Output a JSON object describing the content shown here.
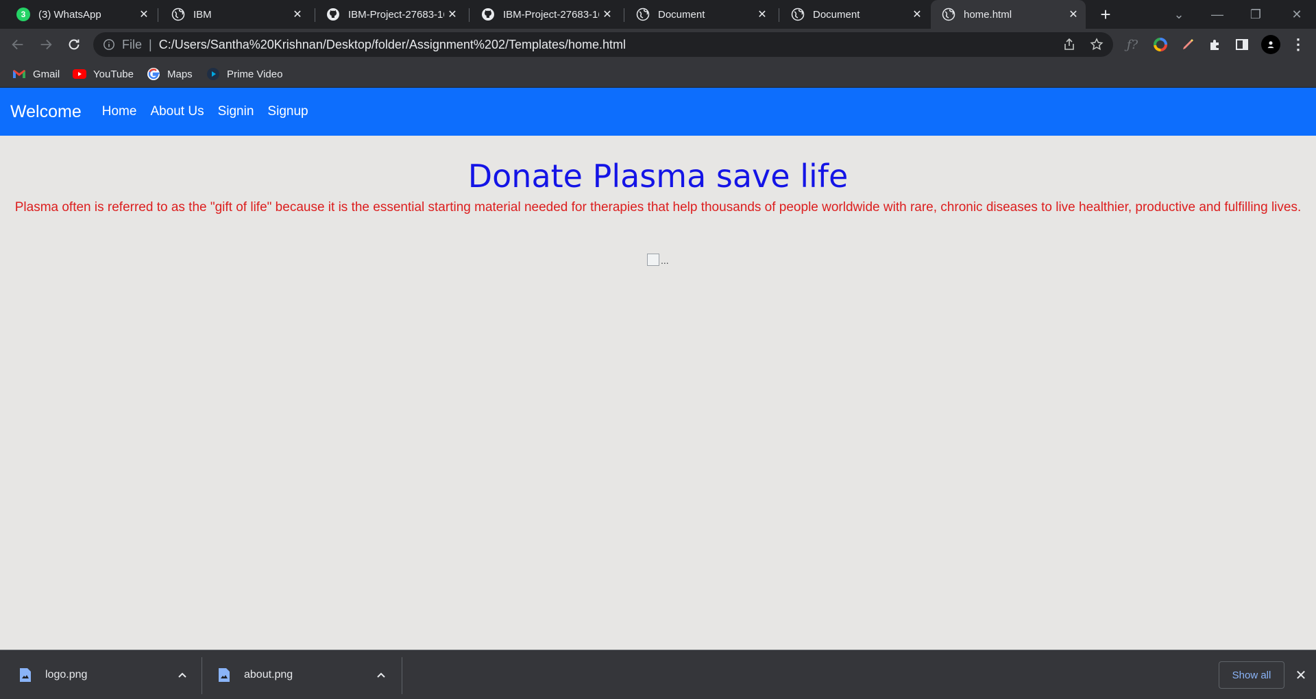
{
  "browser": {
    "tabs": [
      {
        "title": "(3) WhatsApp",
        "icon": "whatsapp-icon",
        "badge": "3"
      },
      {
        "title": "IBM",
        "icon": "globe-icon"
      },
      {
        "title": "IBM-Project-27683-16",
        "icon": "github-icon"
      },
      {
        "title": "IBM-Project-27683-16",
        "icon": "github-icon"
      },
      {
        "title": "Document",
        "icon": "globe-icon"
      },
      {
        "title": "Document",
        "icon": "globe-icon"
      },
      {
        "title": "home.html",
        "icon": "globe-icon",
        "active": true
      }
    ],
    "address": {
      "scheme_label": "File",
      "url": "C:/Users/Santha%20Krishnan/Desktop/folder/Assignment%202/Templates/home.html"
    },
    "bookmarks": [
      {
        "label": "Gmail",
        "icon": "gmail-icon"
      },
      {
        "label": "YouTube",
        "icon": "youtube-icon"
      },
      {
        "label": "Maps",
        "icon": "google-icon"
      },
      {
        "label": "Prime Video",
        "icon": "prime-video-icon"
      }
    ],
    "toolbar_icons": [
      "share-icon",
      "star-icon",
      "formula-icon",
      "color-wheel-icon",
      "pen-icon",
      "puzzle-icon",
      "side-panel-icon",
      "profile-icon",
      "kebab-menu-icon"
    ]
  },
  "page": {
    "brand": "Welcome",
    "nav": [
      "Home",
      "About Us",
      "Signin",
      "Signup"
    ],
    "headline": "Donate Plasma save life",
    "lede": "Plasma often is referred to as the \"gift of life\" because it is the essential starting material needed for therapies that help thousands of people worldwide with rare, chronic diseases to live healthier, productive and fulfilling lives.",
    "image_alt": "..."
  },
  "downloads": {
    "items": [
      {
        "filename": "logo.png"
      },
      {
        "filename": "about.png"
      }
    ],
    "show_all": "Show all"
  },
  "colors": {
    "nav_bg": "#0d6efd",
    "headline": "#1414e6",
    "lede": "#dc1e1e",
    "page_bg": "#e7e6e4"
  }
}
